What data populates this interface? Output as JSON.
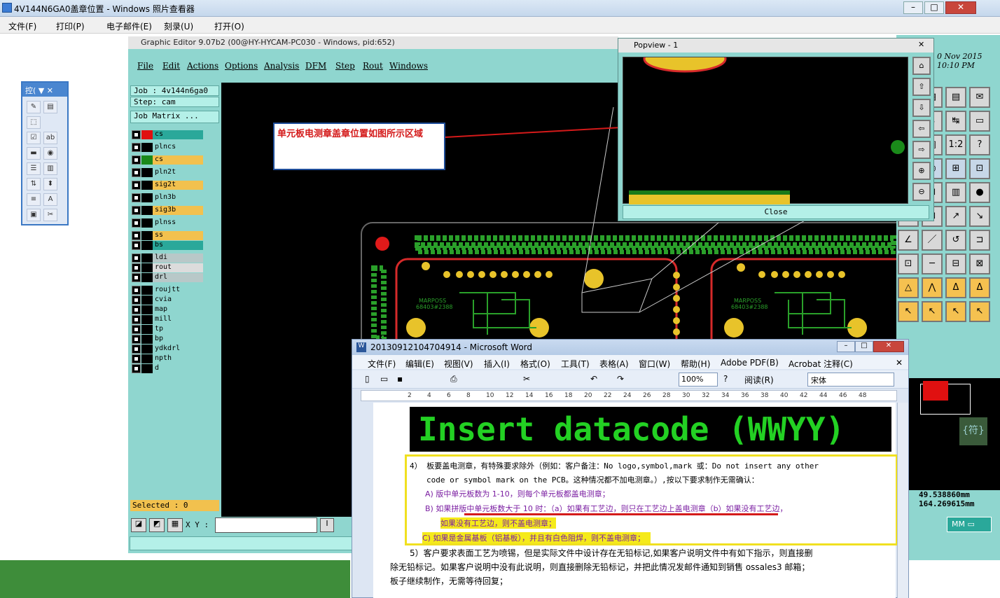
{
  "viewer": {
    "title": "4V144N6GA0盖章位置 - Windows 照片查看器",
    "menu": [
      "文件(F)",
      "打印(P)",
      "电子邮件(E)",
      "刻录(U)",
      "打开(O)"
    ]
  },
  "palette": {
    "title": "控("
  },
  "graphic_editor": {
    "title": "Graphic Editor 9.07b2 (00@HY-HYCAM-PC030 - Windows, pid:652)",
    "menu": [
      "File",
      "Edit",
      "Actions",
      "Options",
      "Analysis",
      "DFM",
      "Step",
      "Rout",
      "Windows"
    ],
    "job": "Job : 4v144n6ga0",
    "step": "Step: cam",
    "job_matrix": "Job Matrix ...",
    "layers": [
      {
        "name": "cs",
        "color": "#2aa89a"
      },
      {
        "name": "plncs",
        "color": "#8fd6cf"
      },
      {
        "name": "cs",
        "color": "#f2c14e"
      },
      {
        "name": "pln2t",
        "color": "#8fd6cf"
      },
      {
        "name": "sig2t",
        "color": "#f2c14e"
      },
      {
        "name": "pln3b",
        "color": "#8fd6cf"
      },
      {
        "name": "sig3b",
        "color": "#f2c14e"
      },
      {
        "name": "plnss",
        "color": "#8fd6cf"
      },
      {
        "name": "ss",
        "color": "#f2c14e"
      },
      {
        "name": "bs",
        "color": "#2aa89a"
      },
      {
        "name": "ldi",
        "color": "#b8c8c8"
      },
      {
        "name": "rout",
        "color": "#dcdcdc"
      },
      {
        "name": "drl",
        "color": "#b8c8c8"
      },
      {
        "name": "roujtt",
        "color": "#8fd6cf"
      },
      {
        "name": "cvia",
        "color": "#8fd6cf"
      },
      {
        "name": "map",
        "color": "#8fd6cf"
      },
      {
        "name": "mill",
        "color": "#8fd6cf"
      },
      {
        "name": "tp",
        "color": "#8fd6cf"
      },
      {
        "name": "bp",
        "color": "#8fd6cf"
      },
      {
        "name": "ydkdrl",
        "color": "#8fd6cf"
      },
      {
        "name": "npth",
        "color": "#8fd6cf"
      },
      {
        "name": "d",
        "color": "#8fd6cf"
      }
    ],
    "selected": "Selected : 0",
    "xy_label": "X Y :",
    "date_line1": "0 Nov 2015",
    "date_line2": "10:10 PM",
    "coord_x": "49.538860mm",
    "coord_y": "164.269615mm",
    "units": "MM"
  },
  "popview": {
    "title": "Popview - 1",
    "close_label": "Close"
  },
  "callout": {
    "text": "单元板电测章盖章位置如图所示区域"
  },
  "pcb_marks": [
    "MARPOSS",
    "68403#2388"
  ],
  "word": {
    "title": "20130912104704914 - Microsoft Word",
    "menu": [
      "文件(F)",
      "编辑(E)",
      "视图(V)",
      "插入(I)",
      "格式(O)",
      "工具(T)",
      "表格(A)",
      "窗口(W)",
      "帮助(H)",
      "Adobe PDF(B)",
      "Acrobat 注释(C)"
    ],
    "zoom": "100%",
    "read_mode": "阅读(R)",
    "font": "宋体",
    "ruler_ticks": [
      "2",
      "4",
      "6",
      "8",
      "10",
      "12",
      "14",
      "16",
      "18",
      "20",
      "22",
      "24",
      "26",
      "28",
      "30",
      "32",
      "34",
      "36",
      "38",
      "40",
      "42",
      "44",
      "46",
      "48"
    ],
    "banner": "Insert datacode (WWYY)",
    "para4_line1": "4）  板要盖电测章，有特殊要求除外（例如：客户备注：No logo,symbol,mark 或：Do not insert any other",
    "para4_line2": "code or symbol mark on the PCB。这种情况都不加电测章。）,按以下要求制作无需确认：",
    "item_a": "A)   版中单元板数为 1-10，则每个单元板都盖电测章；",
    "item_b": "B)   如果拼版中单元板数大于 10 时：（a）如果有工艺边，则只在工艺边上盖电测章（b）如果没有工艺边，",
    "item_b2": "如果没有工艺边，则不盖电测章；",
    "item_c": "C)   如果是金属基板（铝基板），并且有白色阻焊，则不盖电测章；",
    "para5_line1": "5）客户要求表面工艺为喷锡，但是实际文件中设计存在无铅标记,如果客户说明文件中有如下指示，则直接删",
    "para5_line2": "除无铅标记。如果客户说明中没有此说明，则直接删除无铅标记，并把此情况发邮件通知到销售 ossales3 邮箱；",
    "para5_line3": "板子继续制作，无需等待回复；"
  },
  "right_char": "{符}",
  "colors": {
    "teal": "#8fd6cf",
    "pcb_pad": "#e8c32a",
    "trace": "#d62a2a",
    "accent_red": "#d41a1a"
  }
}
